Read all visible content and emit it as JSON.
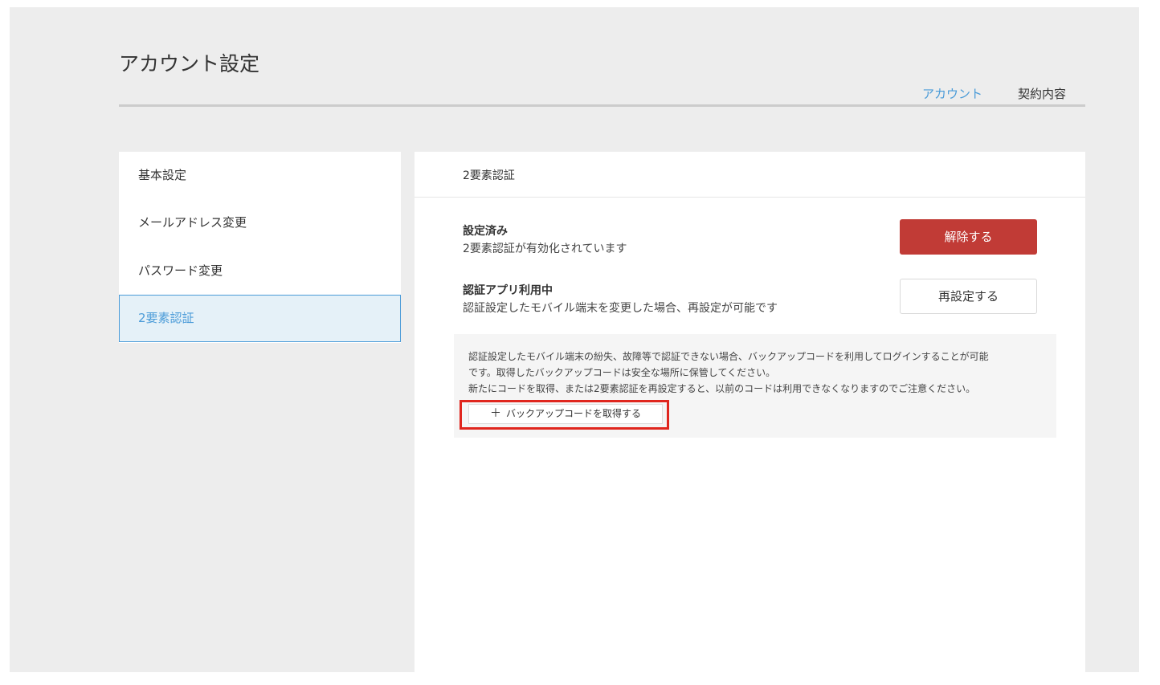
{
  "page": {
    "title": "アカウント設定"
  },
  "tabs": [
    {
      "label": "アカウント",
      "active": true
    },
    {
      "label": "契約内容",
      "active": false
    }
  ],
  "sidebar": {
    "items": [
      {
        "label": "基本設定"
      },
      {
        "label": "メールアドレス変更"
      },
      {
        "label": "パスワード変更"
      },
      {
        "label": "2要素認証",
        "active": true
      }
    ]
  },
  "panel": {
    "title": "2要素認証",
    "status": {
      "title": "設定済み",
      "description": "2要素認証が有効化されています",
      "button_label": "解除する"
    },
    "app": {
      "title": "認証アプリ利用中",
      "description": "認証設定したモバイル端末を変更した場合、再設定が可能です",
      "button_label": "再設定する"
    },
    "notice": {
      "lines": [
        "認証設定したモバイル端末の紛失、故障等で認証できない場合、バックアップコードを利用してログインすることが可能",
        "です。取得したバックアップコードは安全な場所に保管してください。",
        "新たにコードを取得、または2要素認証を再設定すると、以前のコードは利用できなくなりますのでご注意ください。"
      ],
      "backup_button_label": "バックアップコードを取得する",
      "backup_button_icon": "plus-icon"
    }
  },
  "colors": {
    "accent": "#4a9bd8",
    "danger": "#c13b36",
    "highlight": "#e0261e",
    "background": "#ededed"
  }
}
